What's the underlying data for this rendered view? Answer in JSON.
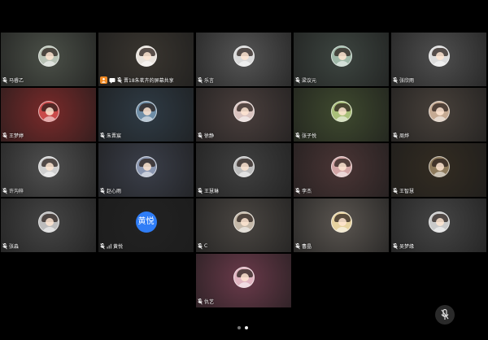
{
  "participants": [
    {
      "name": "马睿乙",
      "bg": "#4b5048",
      "av": "#b8c2b5"
    },
    {
      "name": "晋18朱茗卉的屏幕共享",
      "bg": "#3a3630",
      "av": "#e9e3dc",
      "sharing": true
    },
    {
      "name": "乐言",
      "bg": "#555555",
      "av": "#d9d9d9"
    },
    {
      "name": "梁议元",
      "bg": "#3d4540",
      "av": "#9fb8a8"
    },
    {
      "name": "张欣雨",
      "bg": "#4f4f4f",
      "av": "#dcdcdc"
    },
    {
      "name": "王梦婷",
      "bg": "#7a2a2a",
      "av": "#c94a4a"
    },
    {
      "name": "朱晋宸",
      "bg": "#2f3b45",
      "av": "#6e8da6"
    },
    {
      "name": "徐静",
      "bg": "#4a3f3d",
      "av": "#d9c3bf"
    },
    {
      "name": "张子悦",
      "bg": "#3f4a2f",
      "av": "#a9bf7a"
    },
    {
      "name": "周烨",
      "bg": "#48413b",
      "av": "#c5aa93"
    },
    {
      "name": "许沟梓",
      "bg": "#505050",
      "av": "#cfcfcf"
    },
    {
      "name": "赵心雨",
      "bg": "#3b3f4a",
      "av": "#8a96b0"
    },
    {
      "name": "王慧琳",
      "bg": "#404040",
      "av": "#bdbdbd"
    },
    {
      "name": "李杰",
      "bg": "#4a3535",
      "av": "#d2a5a5"
    },
    {
      "name": "王智慧",
      "bg": "#332c22",
      "av": "#8d7a5c"
    },
    {
      "name": "张淼",
      "bg": "#454545",
      "av": "#bcbcbc"
    },
    {
      "name": "黄悦",
      "bg": "#222222",
      "text_avatar": "黄悦",
      "extra_icon": true
    },
    {
      "name": "C",
      "bg": "#4a4642",
      "av": "#c4b8a8"
    },
    {
      "name": "曹晶",
      "bg": "#5a5550",
      "av": "#e6d2a0"
    },
    {
      "name": "吴梦缘",
      "bg": "#454545",
      "av": "#c9c9c9"
    },
    {
      "name": "仇艺",
      "bg": "#6a3a4a",
      "av": "#e0b4c0",
      "col": 3
    }
  ],
  "pager": {
    "pages": 2,
    "current": 2
  },
  "colors": {
    "share_badge": "#f08a24",
    "text_avatar": "#2f7df6"
  }
}
